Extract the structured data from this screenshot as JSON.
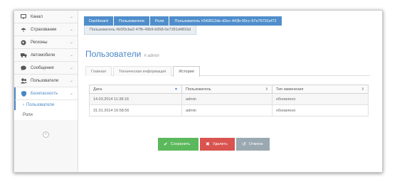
{
  "sidebar": {
    "items": [
      {
        "label": "Канал",
        "icon": "monitor-icon"
      },
      {
        "label": "Страхование",
        "icon": "umbrella-icon"
      },
      {
        "label": "Регионы",
        "icon": "globe-icon"
      },
      {
        "label": "Автомобили",
        "icon": "truck-icon"
      },
      {
        "label": "Сообщения",
        "icon": "comment-icon"
      },
      {
        "label": "Пользователи",
        "icon": "users-icon"
      },
      {
        "label": "Безопасность",
        "icon": "shield-icon"
      }
    ],
    "sub_items": [
      {
        "label": "Пользователи"
      },
      {
        "label": "Роли"
      }
    ]
  },
  "breadcrumbs": {
    "row1": [
      "Dashboard",
      "Пользователи",
      "Роли",
      "Пользователь #343612de-d2ec-443b-90cc-97e76791ef72"
    ],
    "row2": "Пользователь #b0f3cba2-47fb-49b9-b958-0e7281d4816d"
  },
  "page": {
    "title": "Пользователи",
    "subtitle": "# admin"
  },
  "tabs": [
    "Главная",
    "Техническая информация",
    "История"
  ],
  "table": {
    "columns": [
      "Дата",
      "Пользователь",
      "Тип изменения"
    ],
    "rows": [
      [
        "14.03.2014 11:38:16",
        "admin",
        "обновлено"
      ],
      [
        "31.01.2014 16:58:56",
        "admin",
        "обновлено"
      ]
    ]
  },
  "buttons": {
    "save": "Сохранить",
    "delete": "Удалить",
    "cancel": "Отмена"
  }
}
